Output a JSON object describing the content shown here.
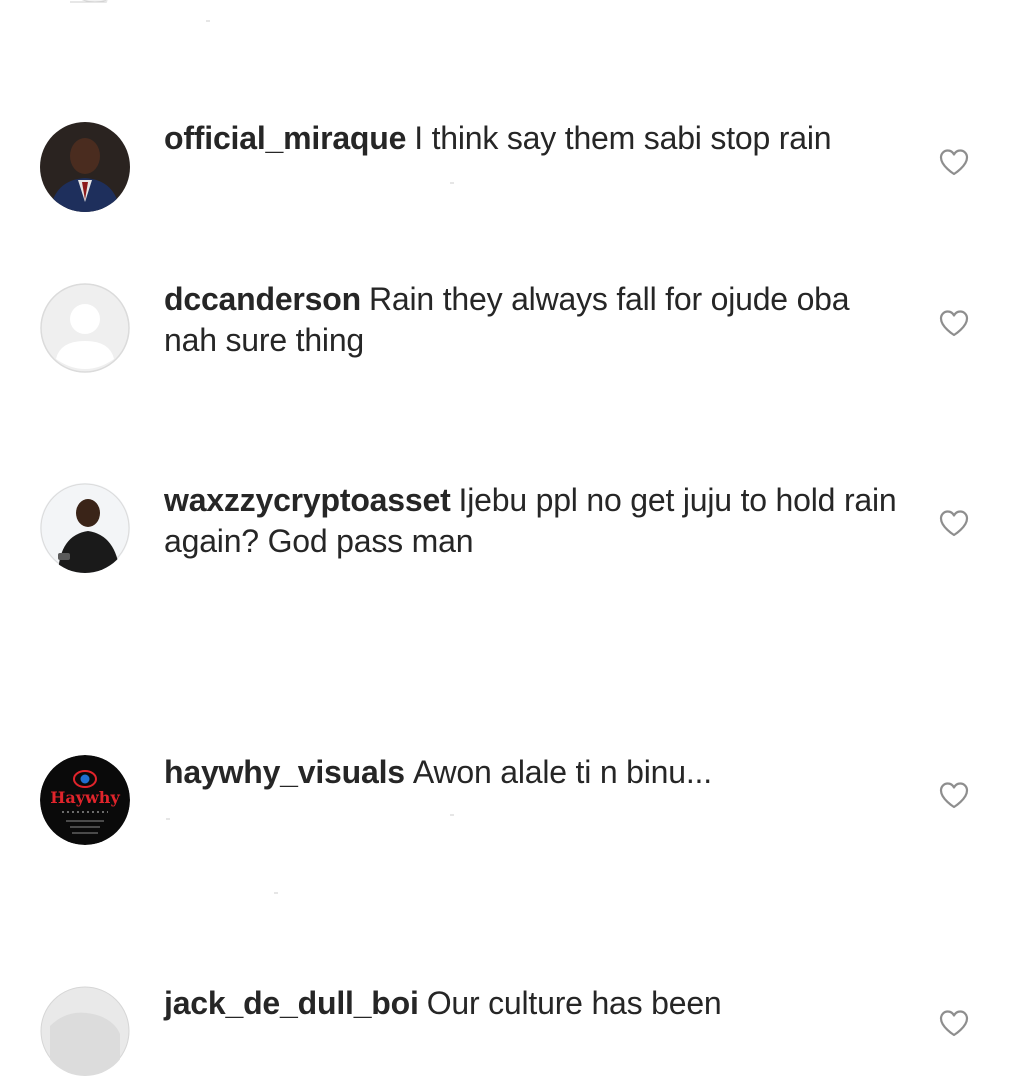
{
  "comments": [
    {
      "username": "official_miraque",
      "text": "I think say them sabi stop rain",
      "avatar_icon": "user-photo-avatar"
    },
    {
      "username": "dccanderson",
      "text": "Rain they always fall for ojude oba nah sure thing",
      "avatar_icon": "default-profile-avatar"
    },
    {
      "username": "waxzzycryptoasset",
      "text": "Ijebu ppl no get juju to hold rain again? God pass man",
      "avatar_icon": "user-photo-avatar"
    },
    {
      "username": "haywhy_visuals",
      "text": "Awon alale ti n binu...",
      "avatar_icon": "brand-logo-avatar",
      "avatar_logo_text": "Haywhy"
    },
    {
      "username": "jack_de_dull_boi",
      "text": "Our culture has been",
      "avatar_icon": "user-photo-avatar"
    }
  ],
  "icons": {
    "like": "heart-outline-icon"
  },
  "colors": {
    "text": "#262626",
    "icon_stroke": "#8e8e8e",
    "background": "#ffffff",
    "haywhy_logo_red": "#e0242b"
  }
}
